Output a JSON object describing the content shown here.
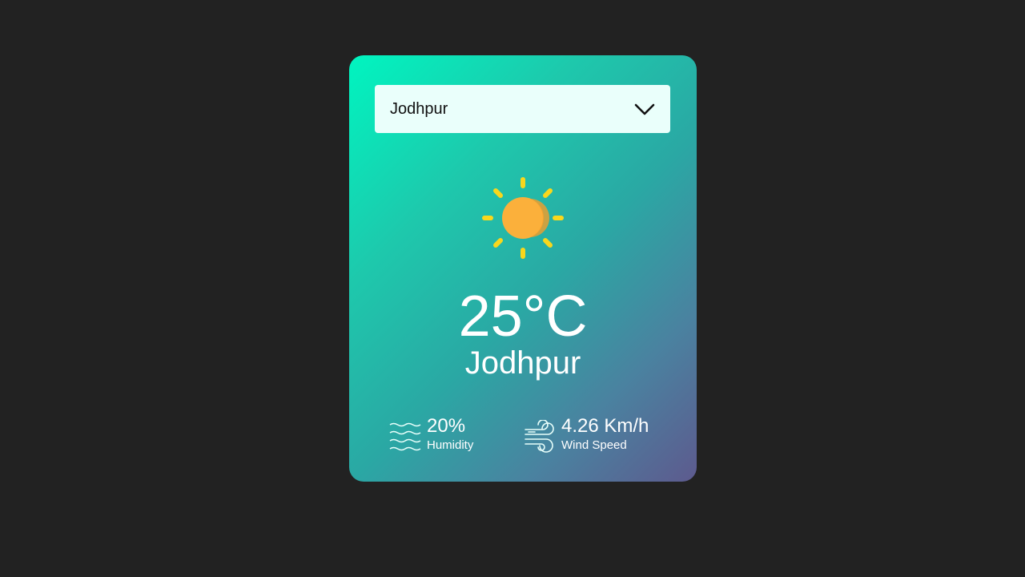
{
  "search": {
    "selected_city": "Jodhpur"
  },
  "weather": {
    "icon": "sun-icon",
    "temperature": "25°C",
    "city": "Jodhpur"
  },
  "details": {
    "humidity_value": "20%",
    "humidity_label": "Humidity",
    "wind_value": "4.26 Km/h",
    "wind_label": "Wind Speed"
  },
  "colors": {
    "page_background": "#222222",
    "card_gradient_start": "#00f5c0",
    "card_gradient_end": "#5d5a8e",
    "select_background": "#eafffb",
    "sun_core": "#fbb03b",
    "sun_rays": "#f9d71c"
  }
}
